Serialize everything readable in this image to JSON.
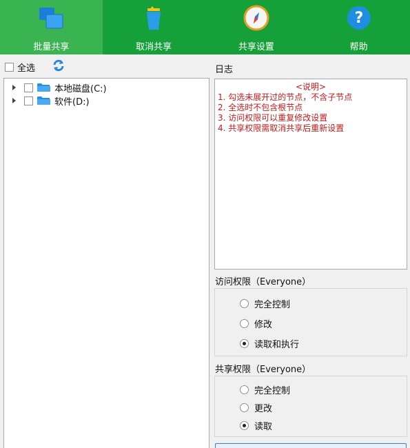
{
  "toolbar": {
    "buttons": [
      {
        "label": "批量共享",
        "icon": "batch-share-icon",
        "active": true
      },
      {
        "label": "取消共享",
        "icon": "trash-icon",
        "active": false
      },
      {
        "label": "共享设置",
        "icon": "compass-icon",
        "active": false
      },
      {
        "label": "帮助",
        "icon": "help-icon",
        "active": false
      }
    ],
    "bg_color": "#16a03a",
    "active_color": "#3ab351"
  },
  "left": {
    "select_all_label": "全选",
    "refresh_icon": "refresh-icon",
    "tree": [
      {
        "label": "本地磁盘(C:)",
        "icon": "folder-icon"
      },
      {
        "label": "软件(D:)",
        "icon": "folder-icon"
      }
    ]
  },
  "log": {
    "title": "日志",
    "heading": "<说明>",
    "lines": [
      "1. 勾选未展开过的节点，不含子节点",
      "2. 全选时不包含根节点",
      "3. 访问权限可以重复修改设置",
      "4. 共享权限需取消共享后重新设置"
    ],
    "text_color": "#c21a1a"
  },
  "access": {
    "title": "访问权限（Everyone）",
    "options": [
      {
        "label": "完全控制",
        "selected": false
      },
      {
        "label": "修改",
        "selected": false
      },
      {
        "label": "读取和执行",
        "selected": true
      }
    ]
  },
  "share": {
    "title": "共享权限（Everyone）",
    "options": [
      {
        "label": "完全控制",
        "selected": false
      },
      {
        "label": "更改",
        "selected": false
      },
      {
        "label": "读取",
        "selected": true
      }
    ]
  }
}
